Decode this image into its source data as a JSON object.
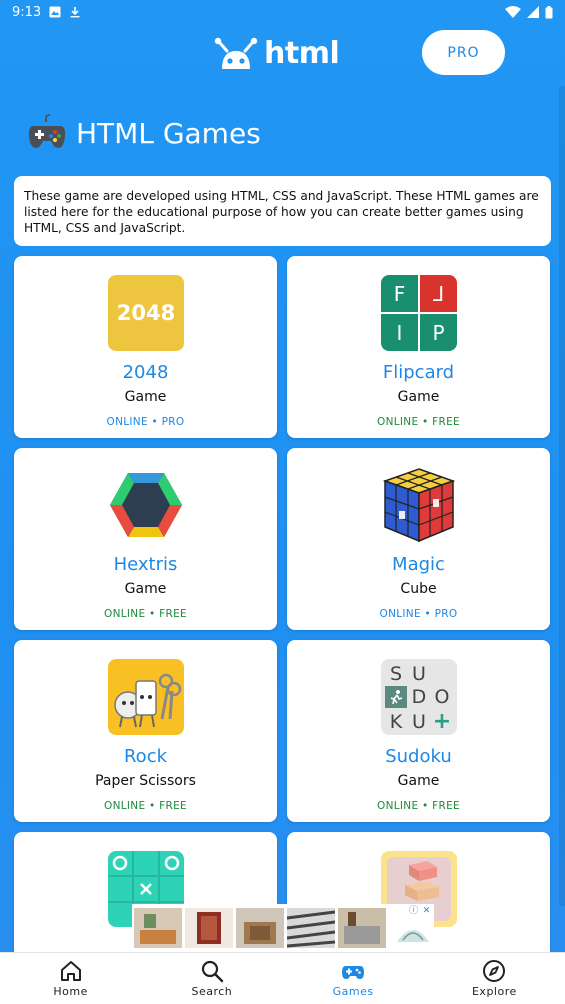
{
  "status_bar": {
    "time": "9:13"
  },
  "header": {
    "logo_text": "html",
    "pro_label": "PRO"
  },
  "page": {
    "title": "HTML Games",
    "intro": "These game are developed using HTML, CSS and JavaScript. These HTML games are listed here for the educational purpose of how you can create better games using HTML, CSS and JavaScript."
  },
  "games": [
    {
      "name": "2048",
      "sub": "Game",
      "tag": "ONLINE • PRO",
      "icon": "2048-icon",
      "thumb_text": "2048"
    },
    {
      "name": "Flipcard",
      "sub": "Game",
      "tag": "ONLINE • FREE",
      "icon": "flipcard-icon",
      "letters": [
        "F",
        "L",
        "I",
        "P"
      ]
    },
    {
      "name": "Hextris",
      "sub": "Game",
      "tag": "ONLINE • FREE",
      "icon": "hextris-icon"
    },
    {
      "name": "Magic",
      "sub": "Cube",
      "tag": "ONLINE • PRO",
      "icon": "rubiks-cube-icon"
    },
    {
      "name": "Rock",
      "sub": "Paper Scissors",
      "tag": "ONLINE • FREE",
      "icon": "rock-paper-scissors-icon"
    },
    {
      "name": "Sudoku",
      "sub": "Game",
      "tag": "ONLINE • FREE",
      "icon": "sudoku-icon",
      "letters": [
        "S",
        "U",
        "D",
        "O",
        "K",
        "U",
        "+"
      ]
    },
    {
      "name": "",
      "sub": "",
      "tag": "",
      "icon": "tic-tac-toe-icon"
    },
    {
      "name": "",
      "sub": "",
      "tag": "",
      "icon": "stack-blocks-icon"
    }
  ],
  "nav": [
    {
      "label": "Home",
      "icon": "home-icon",
      "active": false
    },
    {
      "label": "Search",
      "icon": "search-icon",
      "active": false
    },
    {
      "label": "Games",
      "icon": "gamepad-icon",
      "active": true
    },
    {
      "label": "Explore",
      "icon": "compass-icon",
      "active": false
    }
  ],
  "colors": {
    "brand": "#1e88e5",
    "free": "#1b8a3a",
    "background": "#2196f3"
  }
}
